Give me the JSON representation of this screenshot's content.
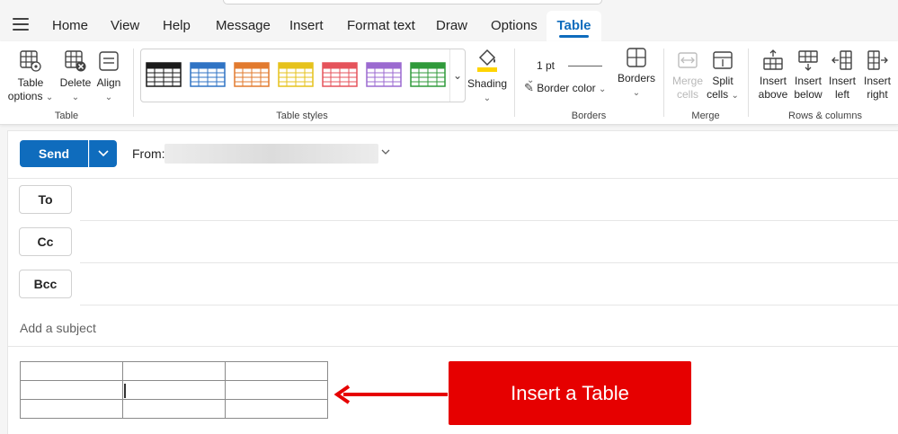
{
  "tabs": [
    "Home",
    "View",
    "Help",
    "Message",
    "Insert",
    "Format text",
    "Draw",
    "Options",
    "Table"
  ],
  "active_tab": "Table",
  "ribbon": {
    "table_group": {
      "table_options": [
        "Table",
        "options"
      ],
      "delete": "Delete",
      "align": "Align",
      "label": "Table"
    },
    "styles_group": {
      "label": "Table styles",
      "swatch_colors": [
        "#1a1a1a",
        "#2f73c4",
        "#e27a2e",
        "#e6c21c",
        "#e5535b",
        "#9b6ad0",
        "#2f9a3a"
      ]
    },
    "shading": "Shading",
    "borders_group": {
      "weight": "1 pt",
      "border_color": "Border color",
      "borders": "Borders",
      "label": "Borders"
    },
    "merge_group": {
      "merge_cells": [
        "Merge",
        "cells"
      ],
      "split_cells": [
        "Split",
        "cells"
      ],
      "label": "Merge"
    },
    "rows_cols_group": {
      "insert_above": [
        "Insert",
        "above"
      ],
      "insert_below": [
        "Insert",
        "below"
      ],
      "insert_left": [
        "Insert",
        "left"
      ],
      "insert_right": [
        "Insert",
        "right"
      ],
      "label": "Rows & columns"
    }
  },
  "compose": {
    "send": "Send",
    "from_label": "From:",
    "to": "To",
    "cc": "Cc",
    "bcc": "Bcc",
    "subject_placeholder": "Add a subject"
  },
  "annotation": {
    "text": "Insert a Table",
    "color": "#e60000"
  },
  "colors": {
    "accent": "#0f6cbd"
  }
}
